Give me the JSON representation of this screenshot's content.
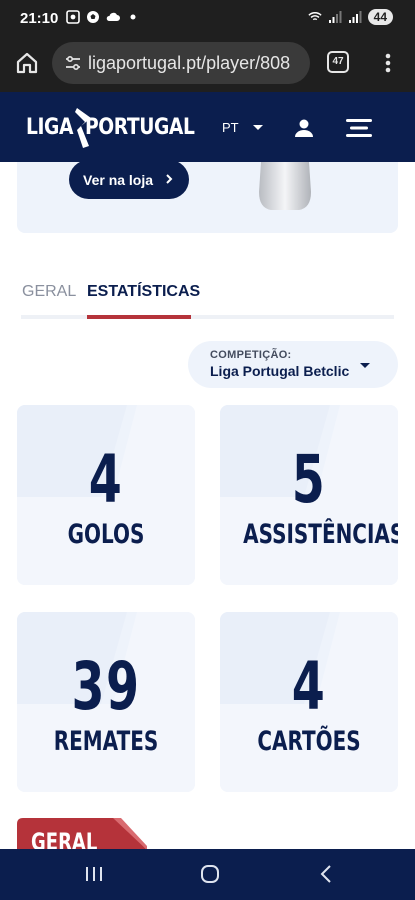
{
  "status_bar": {
    "time": "21:10",
    "battery": "44",
    "icons": [
      "screenshot-icon",
      "soccer-ball-icon",
      "cloud-icon",
      "dot-icon",
      "wifi-icon",
      "signal-icon",
      "signal-icon"
    ]
  },
  "browser": {
    "url": "ligaportugal.pt/player/808",
    "tab_count": "47",
    "icons": [
      "home-icon",
      "tune-icon",
      "more-vert-icon"
    ]
  },
  "header": {
    "logo_word_1": "LIGA",
    "logo_word_2": "PORTUGAL",
    "language": "PT",
    "icons": [
      "user-icon",
      "menu-icon"
    ],
    "background": "#0b1e4e"
  },
  "shop": {
    "button_label": "Ver na loja"
  },
  "tabs": [
    {
      "label": "GERAL",
      "active": false
    },
    {
      "label": "ESTATÍSTICAS",
      "active": true
    }
  ],
  "competition": {
    "label": "COMPETIÇÃO:",
    "value": "Liga Portugal Betclic"
  },
  "stats": [
    {
      "value": "4",
      "label": "GOLOS"
    },
    {
      "value": "5",
      "label": "ASSISTÊNCIAS"
    },
    {
      "value": "39",
      "label": "REMATES"
    },
    {
      "value": "4",
      "label": "CARTÕES"
    }
  ],
  "section_tag": "GERAL",
  "colors": {
    "navy": "#0b1e4e",
    "accent_red": "#b5333a",
    "card_bg": "#eef3fb"
  }
}
